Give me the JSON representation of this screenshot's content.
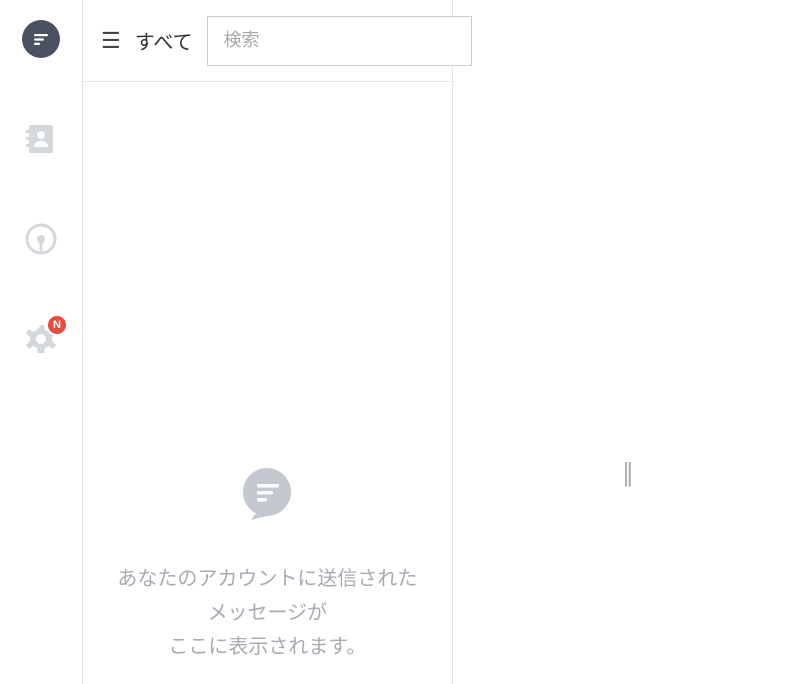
{
  "sidebar": {
    "items": [
      {
        "name": "messages",
        "active": true
      },
      {
        "name": "contacts"
      },
      {
        "name": "broadcast"
      },
      {
        "name": "settings",
        "badge": "N"
      }
    ]
  },
  "topbar": {
    "filter_label": "すべて",
    "search_placeholder": "検索"
  },
  "empty_state": {
    "line1": "あなたのアカウントに送信されたメッセージが",
    "line2": "ここに表示されます。"
  }
}
